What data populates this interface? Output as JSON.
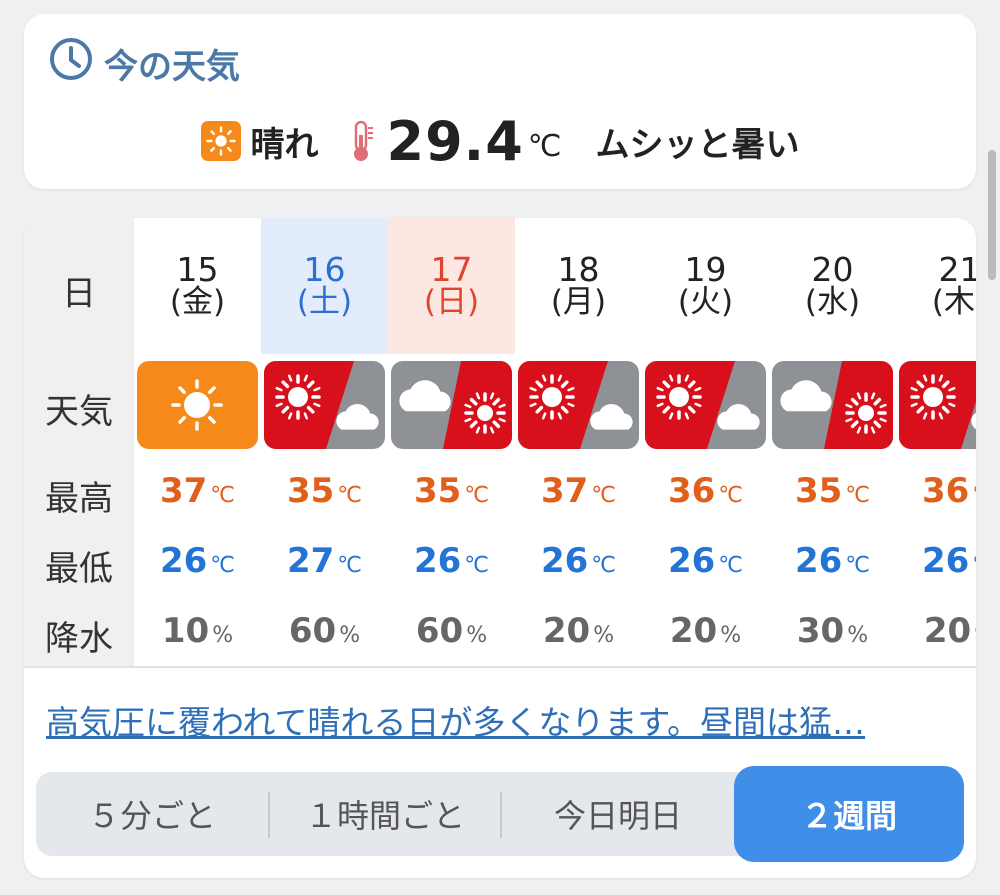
{
  "now": {
    "title": "今の天気",
    "condition": "晴れ",
    "temperature": "29.4",
    "unit": "℃",
    "feel": "ムシッと暑い"
  },
  "labels": {
    "day": "日",
    "weather": "天気",
    "high": "最高",
    "low": "最低",
    "precip": "降水"
  },
  "days": [
    {
      "day": "15",
      "weekday": "(金)",
      "icon": "sunny",
      "high": "37",
      "low": "26",
      "precip": "10",
      "kind": "weekday"
    },
    {
      "day": "16",
      "weekday": "(土)",
      "icon": "very-hot-then-cloudy",
      "high": "35",
      "low": "27",
      "precip": "60",
      "kind": "sat"
    },
    {
      "day": "17",
      "weekday": "(日)",
      "icon": "cloudy-then-very-hot",
      "high": "35",
      "low": "26",
      "precip": "60",
      "kind": "sun"
    },
    {
      "day": "18",
      "weekday": "(月)",
      "icon": "very-hot-then-cloudy",
      "high": "37",
      "low": "26",
      "precip": "20",
      "kind": "weekday"
    },
    {
      "day": "19",
      "weekday": "(火)",
      "icon": "very-hot-then-cloudy",
      "high": "36",
      "low": "26",
      "precip": "20",
      "kind": "weekday"
    },
    {
      "day": "20",
      "weekday": "(水)",
      "icon": "cloudy-then-very-hot",
      "high": "35",
      "low": "26",
      "precip": "30",
      "kind": "weekday"
    },
    {
      "day": "21",
      "weekday": "(木)",
      "icon": "very-hot-then-cloudy",
      "high": "36",
      "low": "26",
      "precip": "20",
      "kind": "weekday"
    }
  ],
  "units": {
    "temp": "℃",
    "precip": "%"
  },
  "summary": "高気圧に覆われて晴れる日が多くなります。昼間は猛…",
  "tabs": [
    {
      "label": "５分ごと",
      "active": false
    },
    {
      "label": "１時間ごと",
      "active": false
    },
    {
      "label": "今日明日",
      "active": false
    },
    {
      "label": "２週間",
      "active": true
    }
  ],
  "colors": {
    "sunny": "#f5891a",
    "very_hot": "#d8101c",
    "cloudy": "#8e9297",
    "high_temp": "#e25e1b",
    "low_temp": "#2474d6",
    "accent": "#3f8fe8",
    "title": "#4a79a8"
  }
}
